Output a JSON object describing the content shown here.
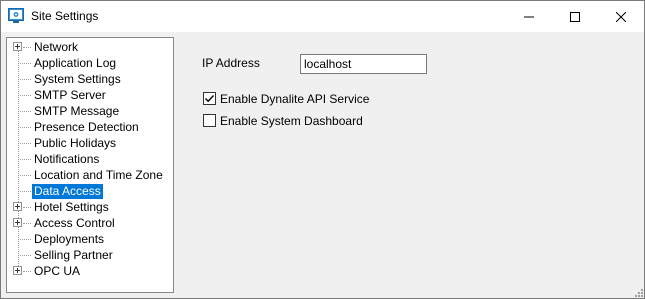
{
  "window": {
    "title": "Site Settings",
    "icon": "site-settings-app-icon"
  },
  "tree": {
    "items": [
      {
        "label": "Network",
        "expandable": true
      },
      {
        "label": "Application Log",
        "expandable": false
      },
      {
        "label": "System Settings",
        "expandable": false
      },
      {
        "label": "SMTP Server",
        "expandable": false
      },
      {
        "label": "SMTP Message",
        "expandable": false
      },
      {
        "label": "Presence Detection",
        "expandable": false
      },
      {
        "label": "Public Holidays",
        "expandable": false
      },
      {
        "label": "Notifications",
        "expandable": false
      },
      {
        "label": "Location and Time Zone",
        "expandable": false
      },
      {
        "label": "Data Access",
        "expandable": false,
        "selected": true
      },
      {
        "label": "Hotel Settings",
        "expandable": true
      },
      {
        "label": "Access Control",
        "expandable": true
      },
      {
        "label": "Deployments",
        "expandable": false
      },
      {
        "label": "Selling Partner",
        "expandable": false
      },
      {
        "label": "OPC UA",
        "expandable": true
      }
    ]
  },
  "panel": {
    "ip_label": "IP Address",
    "ip_value": "localhost",
    "checkboxes": [
      {
        "label": "Enable Dynalite API Service",
        "checked": true
      },
      {
        "label": "Enable System Dashboard",
        "checked": false
      }
    ]
  },
  "colors": {
    "selection": "#0078d7",
    "client_bg": "#f0f0f0"
  }
}
